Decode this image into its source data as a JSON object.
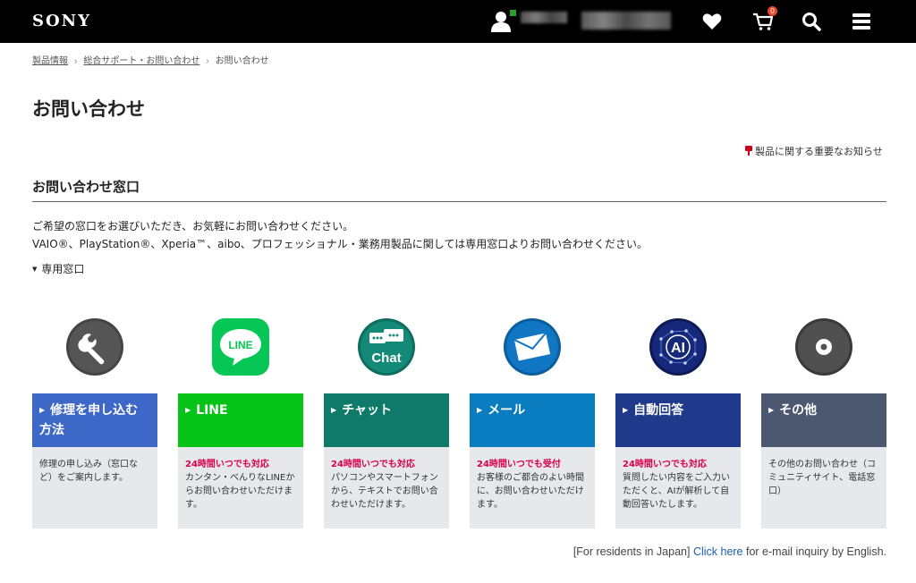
{
  "header": {
    "logo": "SONY",
    "cart_count": "0",
    "icons": [
      "user-icon",
      "heart-icon",
      "cart-icon",
      "search-icon",
      "menu-icon"
    ]
  },
  "breadcrumb": {
    "items": [
      "製品情報",
      "総合サポート・お問い合わせ",
      "お問い合わせ"
    ],
    "separator": "›"
  },
  "page_title": "お問い合わせ",
  "notice_link": "製品に関する重要なお知らせ",
  "section_title": "お問い合わせ窓口",
  "intro": {
    "line1": "ご希望の窓口をお選びいただき、お気軽にお問い合わせください。",
    "line2": "VAIO®、PlayStation®、Xperia™、aibo、プロフェッショナル・業務用製品に関しては専用窓口よりお問い合わせください。"
  },
  "dedicated_label": "専用窓口",
  "cards": [
    {
      "title": "修理を申し込む方法",
      "highlight": "",
      "desc": "修理の申し込み（窓口など）をご案内します。",
      "color": "#3e68c8",
      "icon": "wrench-icon"
    },
    {
      "title": "LINE",
      "highlight": "24時間いつでも対応",
      "desc": "カンタン・べんりなLINEからお問い合わせいただけます。",
      "color": "#06c417",
      "icon": "line-icon"
    },
    {
      "title": "チャット",
      "highlight": "24時間いつでも対応",
      "desc": "パソコンやスマートフォンから、テキストでお問い合わせいただけます。",
      "color": "#0f7a6a",
      "icon": "chat-icon"
    },
    {
      "title": "メール",
      "highlight": "24時間いつでも受付",
      "desc": "お客様のご都合のよい時間に、お問い合わせいただけます。",
      "color": "#0a7cc0",
      "icon": "mail-icon"
    },
    {
      "title": "自動回答",
      "highlight": "24時間いつでも対応",
      "desc": "質問したい内容をご入力いただくと、AIが解析して自動回答いたします。",
      "color": "#1f3a8a",
      "icon": "ai-icon"
    },
    {
      "title": "その他",
      "highlight": "",
      "desc": "その他のお問い合わせ（コミュニティサイト、電話窓口）",
      "color": "#4c5870",
      "icon": "disc-icon"
    }
  ],
  "chat_icon_text": "Chat",
  "line_icon_text": "LINE",
  "ai_icon_text": "AI",
  "footer": {
    "prefix": "[For residents in Japan] ",
    "link": "Click here",
    "suffix": " for e-mail inquiry by English."
  }
}
